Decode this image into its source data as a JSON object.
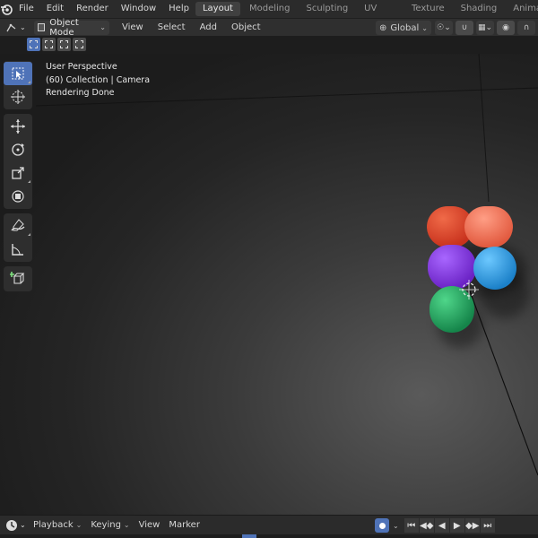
{
  "menubar": {
    "logo_icon": "blender-logo-icon",
    "items": [
      "File",
      "Edit",
      "Render",
      "Window",
      "Help"
    ],
    "workspace_tabs": [
      {
        "label": "Layout",
        "active": true
      },
      {
        "label": "Modeling",
        "active": false
      },
      {
        "label": "Sculpting",
        "active": false
      },
      {
        "label": "UV Editing",
        "active": false
      },
      {
        "label": "Texture Paint",
        "active": false
      },
      {
        "label": "Shading",
        "active": false
      },
      {
        "label": "Animation",
        "active": false
      }
    ]
  },
  "header": {
    "mode": "Object Mode",
    "menus": [
      "View",
      "Select",
      "Add",
      "Object"
    ],
    "transform_orientation": "Global"
  },
  "viewport": {
    "overlay": {
      "perspective": "User Perspective",
      "collection": "(60) Collection | Camera",
      "status": "Rendering Done"
    }
  },
  "toolbar": {
    "tools": [
      "select-box-icon",
      "cursor-icon",
      "move-icon",
      "rotate-icon",
      "scale-icon",
      "transform-icon",
      "annotate-icon",
      "measure-icon",
      "add-cube-icon"
    ]
  },
  "timeline": {
    "menus": [
      {
        "label": "Playback",
        "dropdown": true
      },
      {
        "label": "Keying",
        "dropdown": true
      },
      {
        "label": "View",
        "dropdown": false
      },
      {
        "label": "Marker",
        "dropdown": false
      }
    ]
  },
  "colors": {
    "accent": "#4f73b8",
    "blob_red": "#e0442a",
    "blob_orange": "#f0735a",
    "blob_purple": "#8a3fe0",
    "blob_blue": "#2fa3e8",
    "blob_green": "#22b061"
  }
}
